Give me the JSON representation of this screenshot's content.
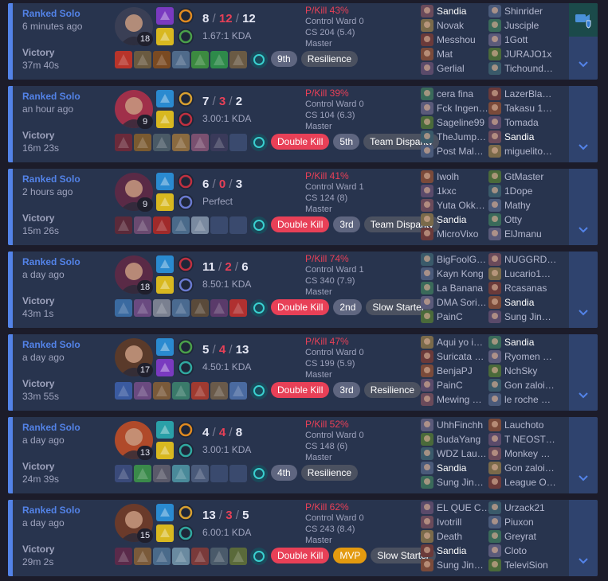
{
  "matches": [
    {
      "queue": "Ranked Solo",
      "time_ago": "6 minutes ago",
      "result": "Victory",
      "duration": "37m 40s",
      "champion_icon": "champion-portrait-dark-hooded",
      "champion_color": "#3a3f55",
      "level": "18",
      "spells": [
        "purple-spell",
        "yellow-spell"
      ],
      "runes": [
        "orange-rune",
        "green-rune"
      ],
      "kills": "8",
      "deaths": "12",
      "assists": "12",
      "ratio": "1.67:1 KDA",
      "items": [
        "#b8342a",
        "#6a5a40",
        "#7a4a22",
        "#4f6a8a",
        "#3c8a40",
        "#2e8a4a",
        "#6a5a44"
      ],
      "ward": "teal-ward",
      "badges": [
        {
          "label": "9th",
          "style": "gray"
        },
        {
          "label": "Resilience",
          "style": "dark"
        }
      ],
      "pkill": "P/Kill 43%",
      "control_ward": "Control Ward 0",
      "cs": "CS 204 (5.4)",
      "rank": "Master",
      "team_a": [
        "Sandia",
        "Novak",
        "Messhou",
        "Mat",
        "Gerlial"
      ],
      "team_b": [
        "Shinrider",
        "Jusciple",
        "1Gott",
        "JURAJO1x",
        "Tichound…"
      ],
      "me_team": "a",
      "me_index": 0,
      "spectate": true
    },
    {
      "queue": "Ranked Solo",
      "time_ago": "an hour ago",
      "result": "Victory",
      "duration": "16m 23s",
      "champion_icon": "champion-portrait-pink-hair",
      "champion_color": "#a0304a",
      "level": "9",
      "spells": [
        "blue-spell",
        "yellow-spell"
      ],
      "runes": [
        "gold-rune",
        "red-rune"
      ],
      "kills": "7",
      "deaths": "3",
      "assists": "2",
      "ratio": "3.00:1 KDA",
      "items": [
        "#6a2a3a",
        "#7a5a30",
        "#4a5a66",
        "#8a6a40",
        "#7a5070",
        "#3a3a5a",
        ""
      ],
      "ward": "teal-ward",
      "badges": [
        {
          "label": "Double Kill",
          "style": "red"
        },
        {
          "label": "5th",
          "style": "gray"
        },
        {
          "label": "Team Disparity",
          "style": "dark"
        }
      ],
      "pkill": "P/Kill 39%",
      "control_ward": "Control Ward 0",
      "cs": "CS 104 (6.3)",
      "rank": "Master",
      "team_a": [
        "cera fina",
        "Fck Ingen…",
        "Sageline99",
        "TheJump…",
        "Post Mal…"
      ],
      "team_b": [
        "LazerBla…",
        "Takasu 1…",
        "Tomada",
        "Sandia",
        "miguelito…"
      ],
      "me_team": "b",
      "me_index": 3,
      "spectate": false
    },
    {
      "queue": "Ranked Solo",
      "time_ago": "2 hours ago",
      "result": "Victory",
      "duration": "15m 26s",
      "champion_icon": "champion-portrait-crimson-assassin",
      "champion_color": "#5a2a46",
      "level": "9",
      "spells": [
        "blue-spell",
        "yellow-spell"
      ],
      "runes": [
        "red-rune",
        "blue-rune"
      ],
      "kills": "6",
      "deaths": "0",
      "assists": "3",
      "ratio": "Perfect",
      "items": [
        "#5a2a3a",
        "#6a4a70",
        "#a02a2a",
        "#4a6a8a",
        "#7a8aa0",
        "",
        ""
      ],
      "ward": "teal-ward",
      "badges": [
        {
          "label": "Double Kill",
          "style": "red"
        },
        {
          "label": "3rd",
          "style": "gray"
        },
        {
          "label": "Team Disparity",
          "style": "dark"
        }
      ],
      "pkill": "P/Kill 41%",
      "control_ward": "Control Ward 1",
      "cs": "CS 124 (8)",
      "rank": "Master",
      "team_a": [
        "Iwolh",
        "1kxc",
        "Yuta Okk…",
        "Sandia",
        "MicroVixo"
      ],
      "team_b": [
        "GtMaster",
        "1Dope",
        "Mathy",
        "Otty",
        "ElJmanu"
      ],
      "me_team": "a",
      "me_index": 3,
      "spectate": false
    },
    {
      "queue": "Ranked Solo",
      "time_ago": "a day ago",
      "result": "Victory",
      "duration": "43m 1s",
      "champion_icon": "champion-portrait-crimson-assassin",
      "champion_color": "#5a2a46",
      "level": "18",
      "spells": [
        "blue-spell",
        "yellow-spell"
      ],
      "runes": [
        "red-rune",
        "blue-rune"
      ],
      "kills": "11",
      "deaths": "2",
      "assists": "6",
      "ratio": "8.50:1 KDA",
      "items": [
        "#3a6aa0",
        "#6a4a80",
        "#7a8090",
        "#4a6a90",
        "#5a4a3a",
        "#5a3a6a",
        "#b03030"
      ],
      "ward": "teal-ward",
      "badges": [
        {
          "label": "Double Kill",
          "style": "red"
        },
        {
          "label": "2nd",
          "style": "gray"
        },
        {
          "label": "Slow Starter",
          "style": "dark"
        }
      ],
      "pkill": "P/Kill 74%",
      "control_ward": "Control Ward 1",
      "cs": "CS 340 (7.9)",
      "rank": "Master",
      "team_a": [
        "BigFoolG…",
        "Kayn Kong",
        "La Banana",
        "DMA Sori…",
        "PainC"
      ],
      "team_b": [
        "NUGGRD…",
        "Lucario1…",
        "Rcasanas",
        "Sandia",
        "Sung Jin…"
      ],
      "me_team": "b",
      "me_index": 3,
      "spectate": false
    },
    {
      "queue": "Ranked Solo",
      "time_ago": "a day ago",
      "result": "Victory",
      "duration": "33m 55s",
      "champion_icon": "champion-portrait-bald-brawler",
      "champion_color": "#5a3a2a",
      "level": "17",
      "spells": [
        "blue-spell",
        "purple-spell"
      ],
      "runes": [
        "green-rune",
        "teal-rune"
      ],
      "kills": "5",
      "deaths": "4",
      "assists": "13",
      "ratio": "4.50:1 KDA",
      "items": [
        "#3a5aa0",
        "#6a4a80",
        "#7a5a3a",
        "#3a7a6a",
        "#a03a30",
        "#6a5a4a",
        "#4a6aa0"
      ],
      "ward": "teal-ward",
      "badges": [
        {
          "label": "Double Kill",
          "style": "red"
        },
        {
          "label": "3rd",
          "style": "gray"
        },
        {
          "label": "Resilience",
          "style": "dark"
        }
      ],
      "pkill": "P/Kill 47%",
      "control_ward": "Control Ward 0",
      "cs": "CS 199 (5.9)",
      "rank": "Master",
      "team_a": [
        "Aqui yo i…",
        "Suricata …",
        "BenjaPJ",
        "PainC",
        "Mewing …"
      ],
      "team_b": [
        "Sandia",
        "Ryomen …",
        "NchSky",
        "Gon zaloi…",
        "le roche …"
      ],
      "me_team": "b",
      "me_index": 0,
      "spectate": false
    },
    {
      "queue": "Ranked Solo",
      "time_ago": "a day ago",
      "result": "Victory",
      "duration": "24m 39s",
      "champion_icon": "champion-portrait-red-fox",
      "champion_color": "#b04a2a",
      "level": "13",
      "spells": [
        "teal-spell",
        "yellow-spell"
      ],
      "runes": [
        "orange-rune",
        "teal-rune"
      ],
      "kills": "4",
      "deaths": "4",
      "assists": "8",
      "ratio": "3.00:1 KDA",
      "items": [
        "#3a4a7a",
        "#3a8a4a",
        "#5a5a6a",
        "#4a8a9a",
        "#4a5a7a",
        "",
        ""
      ],
      "ward": "teal-ward",
      "badges": [
        {
          "label": "4th",
          "style": "gray"
        },
        {
          "label": "Resilience",
          "style": "dark"
        }
      ],
      "pkill": "P/Kill 52%",
      "control_ward": "Control Ward 0",
      "cs": "CS 148 (6)",
      "rank": "Master",
      "team_a": [
        "UhhFinchh",
        "BudaYang",
        "WDZ Lau…",
        "Sandia",
        "Sung Jin…"
      ],
      "team_b": [
        "Lauchoto",
        "T NEOST…",
        "Monkey …",
        "Gon zaloi…",
        "League O…"
      ],
      "me_team": "a",
      "me_index": 3,
      "spectate": false
    },
    {
      "queue": "Ranked Solo",
      "time_ago": "a day ago",
      "result": "Victory",
      "duration": "29m 2s",
      "champion_icon": "champion-portrait-armored-general",
      "champion_color": "#6a3a2a",
      "level": "15",
      "spells": [
        "blue-spell",
        "yellow-spell"
      ],
      "runes": [
        "gold-rune",
        "teal-rune"
      ],
      "kills": "13",
      "deaths": "3",
      "assists": "5",
      "ratio": "6.00:1 KDA",
      "items": [
        "#5a2a4a",
        "#7a5a3a",
        "#4a6a8a",
        "#6a8aa0",
        "#7a3a3a",
        "#4a5a6a",
        "#5a6a3a"
      ],
      "ward": "teal-ward",
      "badges": [
        {
          "label": "Double Kill",
          "style": "red"
        },
        {
          "label": "MVP",
          "style": "gold"
        },
        {
          "label": "Slow Starter",
          "style": "dark"
        }
      ],
      "pkill": "P/Kill 62%",
      "control_ward": "Control Ward 0",
      "cs": "CS 243 (8.4)",
      "rank": "Master",
      "team_a": [
        "EL QUE C…",
        "Ivotrill",
        "Death",
        "Sandia",
        "Sung Jin…"
      ],
      "team_b": [
        "Urzack21",
        "Piuxon",
        "Greyrat",
        "Cloto",
        "TeleviSion"
      ],
      "me_team": "a",
      "me_index": 3,
      "spectate": false
    }
  ],
  "colors": {
    "win_accent": "#5383e8",
    "panel": "#28344e",
    "death_red": "#e84057",
    "expand_bar": "#2f436e"
  }
}
